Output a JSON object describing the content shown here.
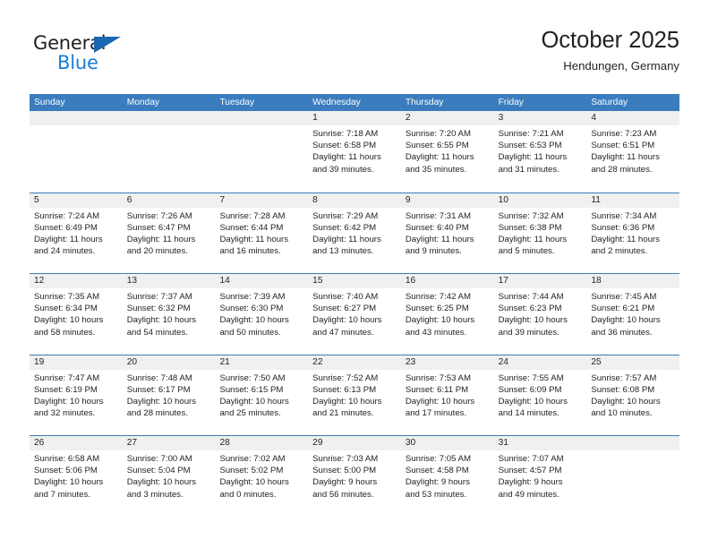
{
  "brand": {
    "name_part1": "General",
    "name_part2": "Blue",
    "triangle_color": "#1b66b0",
    "blue_color": "#1b7fd4",
    "dark_color": "#231f20"
  },
  "header": {
    "title": "October 2025",
    "subtitle": "Hendungen, Germany"
  },
  "theme": {
    "header_bar_color": "#3a7cbe",
    "day_strip_color": "#f0f0f0",
    "text_color": "#231f20"
  },
  "weekdays": [
    "Sunday",
    "Monday",
    "Tuesday",
    "Wednesday",
    "Thursday",
    "Friday",
    "Saturday"
  ],
  "weeks": [
    [
      {
        "day": "",
        "lines": []
      },
      {
        "day": "",
        "lines": []
      },
      {
        "day": "",
        "lines": []
      },
      {
        "day": "1",
        "lines": [
          "Sunrise: 7:18 AM",
          "Sunset: 6:58 PM",
          "Daylight: 11 hours",
          "and 39 minutes."
        ]
      },
      {
        "day": "2",
        "lines": [
          "Sunrise: 7:20 AM",
          "Sunset: 6:55 PM",
          "Daylight: 11 hours",
          "and 35 minutes."
        ]
      },
      {
        "day": "3",
        "lines": [
          "Sunrise: 7:21 AM",
          "Sunset: 6:53 PM",
          "Daylight: 11 hours",
          "and 31 minutes."
        ]
      },
      {
        "day": "4",
        "lines": [
          "Sunrise: 7:23 AM",
          "Sunset: 6:51 PM",
          "Daylight: 11 hours",
          "and 28 minutes."
        ]
      }
    ],
    [
      {
        "day": "5",
        "lines": [
          "Sunrise: 7:24 AM",
          "Sunset: 6:49 PM",
          "Daylight: 11 hours",
          "and 24 minutes."
        ]
      },
      {
        "day": "6",
        "lines": [
          "Sunrise: 7:26 AM",
          "Sunset: 6:47 PM",
          "Daylight: 11 hours",
          "and 20 minutes."
        ]
      },
      {
        "day": "7",
        "lines": [
          "Sunrise: 7:28 AM",
          "Sunset: 6:44 PM",
          "Daylight: 11 hours",
          "and 16 minutes."
        ]
      },
      {
        "day": "8",
        "lines": [
          "Sunrise: 7:29 AM",
          "Sunset: 6:42 PM",
          "Daylight: 11 hours",
          "and 13 minutes."
        ]
      },
      {
        "day": "9",
        "lines": [
          "Sunrise: 7:31 AM",
          "Sunset: 6:40 PM",
          "Daylight: 11 hours",
          "and 9 minutes."
        ]
      },
      {
        "day": "10",
        "lines": [
          "Sunrise: 7:32 AM",
          "Sunset: 6:38 PM",
          "Daylight: 11 hours",
          "and 5 minutes."
        ]
      },
      {
        "day": "11",
        "lines": [
          "Sunrise: 7:34 AM",
          "Sunset: 6:36 PM",
          "Daylight: 11 hours",
          "and 2 minutes."
        ]
      }
    ],
    [
      {
        "day": "12",
        "lines": [
          "Sunrise: 7:35 AM",
          "Sunset: 6:34 PM",
          "Daylight: 10 hours",
          "and 58 minutes."
        ]
      },
      {
        "day": "13",
        "lines": [
          "Sunrise: 7:37 AM",
          "Sunset: 6:32 PM",
          "Daylight: 10 hours",
          "and 54 minutes."
        ]
      },
      {
        "day": "14",
        "lines": [
          "Sunrise: 7:39 AM",
          "Sunset: 6:30 PM",
          "Daylight: 10 hours",
          "and 50 minutes."
        ]
      },
      {
        "day": "15",
        "lines": [
          "Sunrise: 7:40 AM",
          "Sunset: 6:27 PM",
          "Daylight: 10 hours",
          "and 47 minutes."
        ]
      },
      {
        "day": "16",
        "lines": [
          "Sunrise: 7:42 AM",
          "Sunset: 6:25 PM",
          "Daylight: 10 hours",
          "and 43 minutes."
        ]
      },
      {
        "day": "17",
        "lines": [
          "Sunrise: 7:44 AM",
          "Sunset: 6:23 PM",
          "Daylight: 10 hours",
          "and 39 minutes."
        ]
      },
      {
        "day": "18",
        "lines": [
          "Sunrise: 7:45 AM",
          "Sunset: 6:21 PM",
          "Daylight: 10 hours",
          "and 36 minutes."
        ]
      }
    ],
    [
      {
        "day": "19",
        "lines": [
          "Sunrise: 7:47 AM",
          "Sunset: 6:19 PM",
          "Daylight: 10 hours",
          "and 32 minutes."
        ]
      },
      {
        "day": "20",
        "lines": [
          "Sunrise: 7:48 AM",
          "Sunset: 6:17 PM",
          "Daylight: 10 hours",
          "and 28 minutes."
        ]
      },
      {
        "day": "21",
        "lines": [
          "Sunrise: 7:50 AM",
          "Sunset: 6:15 PM",
          "Daylight: 10 hours",
          "and 25 minutes."
        ]
      },
      {
        "day": "22",
        "lines": [
          "Sunrise: 7:52 AM",
          "Sunset: 6:13 PM",
          "Daylight: 10 hours",
          "and 21 minutes."
        ]
      },
      {
        "day": "23",
        "lines": [
          "Sunrise: 7:53 AM",
          "Sunset: 6:11 PM",
          "Daylight: 10 hours",
          "and 17 minutes."
        ]
      },
      {
        "day": "24",
        "lines": [
          "Sunrise: 7:55 AM",
          "Sunset: 6:09 PM",
          "Daylight: 10 hours",
          "and 14 minutes."
        ]
      },
      {
        "day": "25",
        "lines": [
          "Sunrise: 7:57 AM",
          "Sunset: 6:08 PM",
          "Daylight: 10 hours",
          "and 10 minutes."
        ]
      }
    ],
    [
      {
        "day": "26",
        "lines": [
          "Sunrise: 6:58 AM",
          "Sunset: 5:06 PM",
          "Daylight: 10 hours",
          "and 7 minutes."
        ]
      },
      {
        "day": "27",
        "lines": [
          "Sunrise: 7:00 AM",
          "Sunset: 5:04 PM",
          "Daylight: 10 hours",
          "and 3 minutes."
        ]
      },
      {
        "day": "28",
        "lines": [
          "Sunrise: 7:02 AM",
          "Sunset: 5:02 PM",
          "Daylight: 10 hours",
          "and 0 minutes."
        ]
      },
      {
        "day": "29",
        "lines": [
          "Sunrise: 7:03 AM",
          "Sunset: 5:00 PM",
          "Daylight: 9 hours",
          "and 56 minutes."
        ]
      },
      {
        "day": "30",
        "lines": [
          "Sunrise: 7:05 AM",
          "Sunset: 4:58 PM",
          "Daylight: 9 hours",
          "and 53 minutes."
        ]
      },
      {
        "day": "31",
        "lines": [
          "Sunrise: 7:07 AM",
          "Sunset: 4:57 PM",
          "Daylight: 9 hours",
          "and 49 minutes."
        ]
      },
      {
        "day": "",
        "lines": []
      }
    ]
  ]
}
